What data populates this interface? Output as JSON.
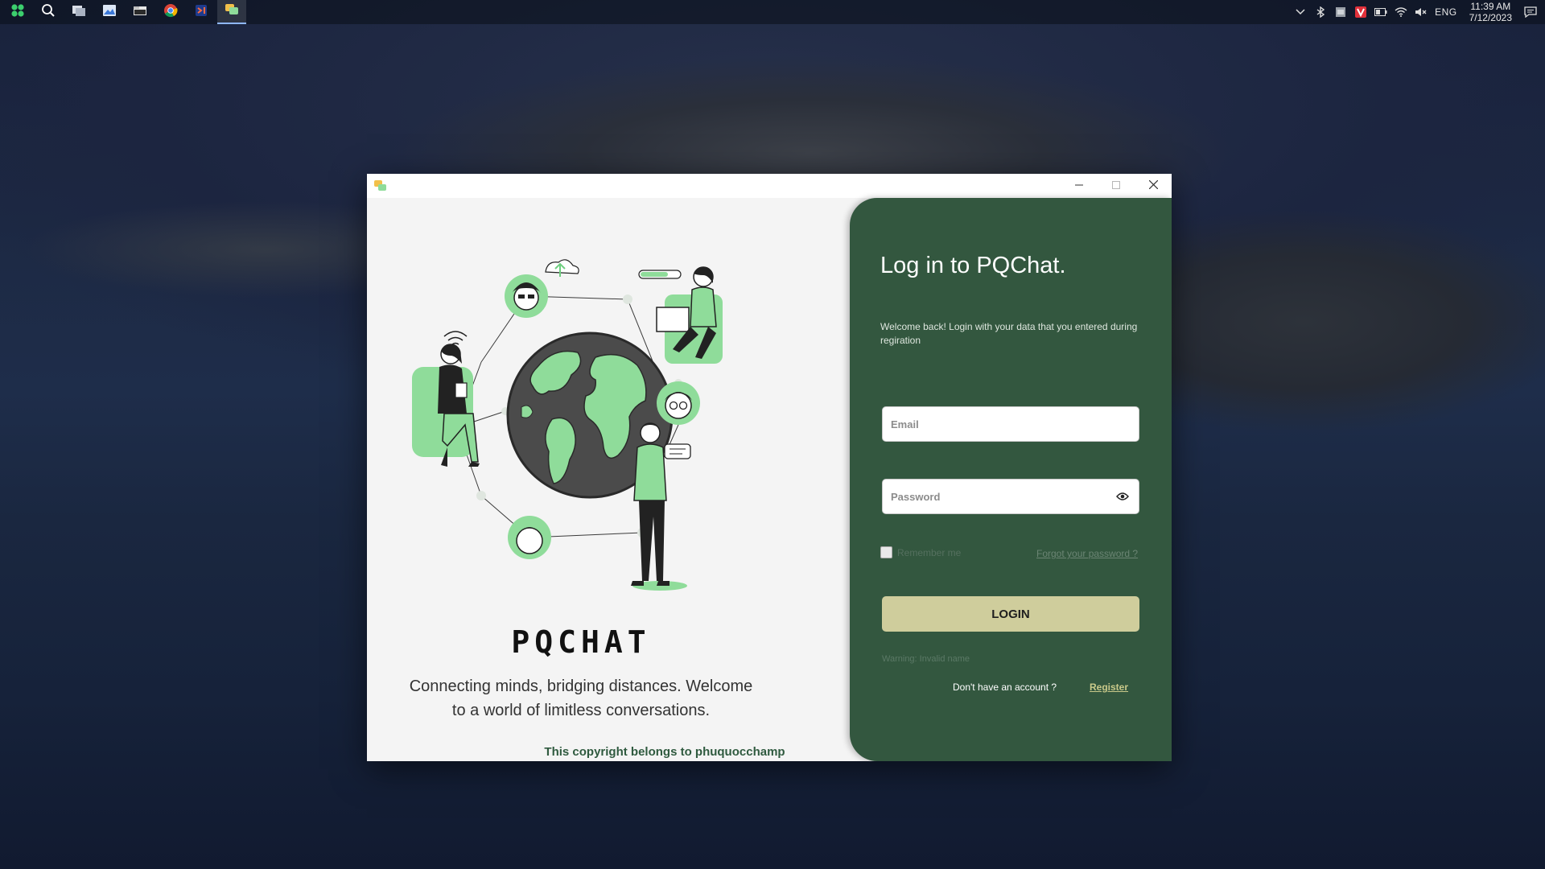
{
  "taskbar": {
    "apps": [
      {
        "name": "start-icon"
      },
      {
        "name": "search-icon"
      },
      {
        "name": "task-view-icon"
      },
      {
        "name": "photos-icon"
      },
      {
        "name": "file-explorer-icon"
      },
      {
        "name": "chrome-icon"
      },
      {
        "name": "visual-studio-icon"
      },
      {
        "name": "pqchat-app-icon"
      }
    ],
    "tray": {
      "lang": "ENG",
      "time": "11:39 AM",
      "date": "7/12/2023"
    }
  },
  "window": {
    "controls": {
      "minimize": "minimize-icon",
      "maximize": "maximize-icon",
      "close": "close-icon"
    }
  },
  "left": {
    "brand": "PQCHAT",
    "tagline": "Connecting minds, bridging distances. Welcome to a world of limitless conversations.",
    "copyright": "This copyright belongs to phuquocchamp"
  },
  "login": {
    "title": "Log in to PQChat.",
    "subtitle": "Welcome back! Login with your data that you entered during regiration",
    "email_placeholder": "Email",
    "email_value": "",
    "password_placeholder": "Password",
    "password_value": "",
    "remember_label": "Remember me",
    "remember_checked": false,
    "forgot_label": "Forgot your password ?",
    "login_button": "LOGIN",
    "warning": "Warning: Invalid name",
    "no_account": "Don't have an account ?",
    "register": "Register"
  },
  "colors": {
    "panel_green": "#33573f",
    "button_khaki": "#cfcd9c",
    "accent_green": "#8fdc9a"
  }
}
